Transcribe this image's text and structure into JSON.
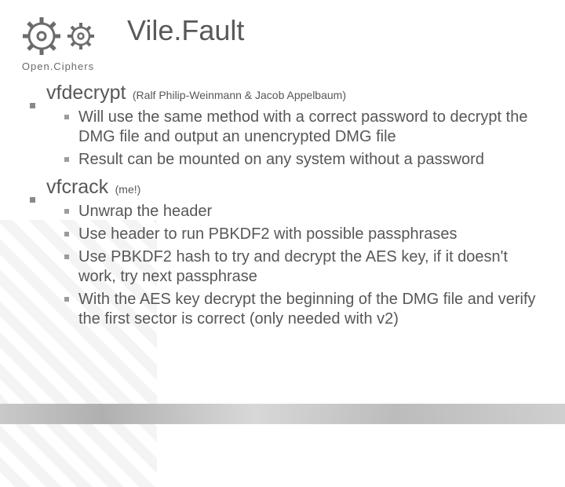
{
  "logo": {
    "text": "Open.Ciphers"
  },
  "title": "Vile.Fault",
  "sections": [
    {
      "heading": "vfdecrypt",
      "subheading": "(Ralf Philip-Weinmann & Jacob Appelbaum)",
      "items": [
        "Will use the same method with a correct password to decrypt the DMG file and output an unencrypted DMG file",
        "Result can be mounted on any system without a password"
      ]
    },
    {
      "heading": "vfcrack",
      "subheading": "(me!)",
      "items": [
        "Unwrap the header",
        "Use header to run PBKDF2 with possible passphrases",
        "Use PBKDF2 hash to try and decrypt the AES key, if it doesn't work, try next passphrase",
        "With the AES key decrypt the beginning of the DMG file and verify the first sector is correct (only needed with v2)"
      ]
    }
  ]
}
